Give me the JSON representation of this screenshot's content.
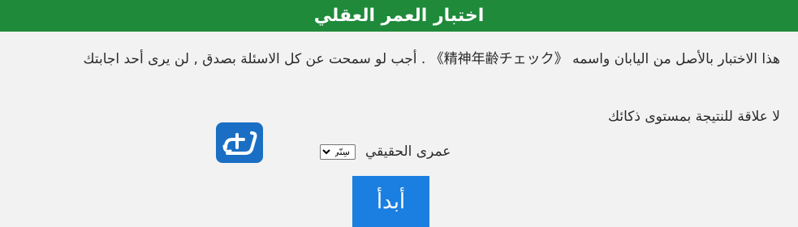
{
  "header": {
    "title": "اختبار العمر العقلي"
  },
  "intro": {
    "text": "هذا الاختبار بالأصل من اليابان واسمه 《精神年齢チェック》 . أجب لو سمحت عن كل الاسئلة بصدق , لن يرى أحد اجابتك"
  },
  "note": {
    "text": "لا علاقة للنتيجة بمستوى ذكائك"
  },
  "logo": {
    "icon": "almrsal-logo-icon",
    "accent": "#1a6fc4"
  },
  "age": {
    "label": "عمرى الحقيقي",
    "selected": "سِنّي"
  },
  "start_button": {
    "label": "أبدأ"
  },
  "colors": {
    "header_bg": "#1e8a3a",
    "page_bg": "#f2f2f2",
    "button_bg": "#1a7fe0"
  }
}
